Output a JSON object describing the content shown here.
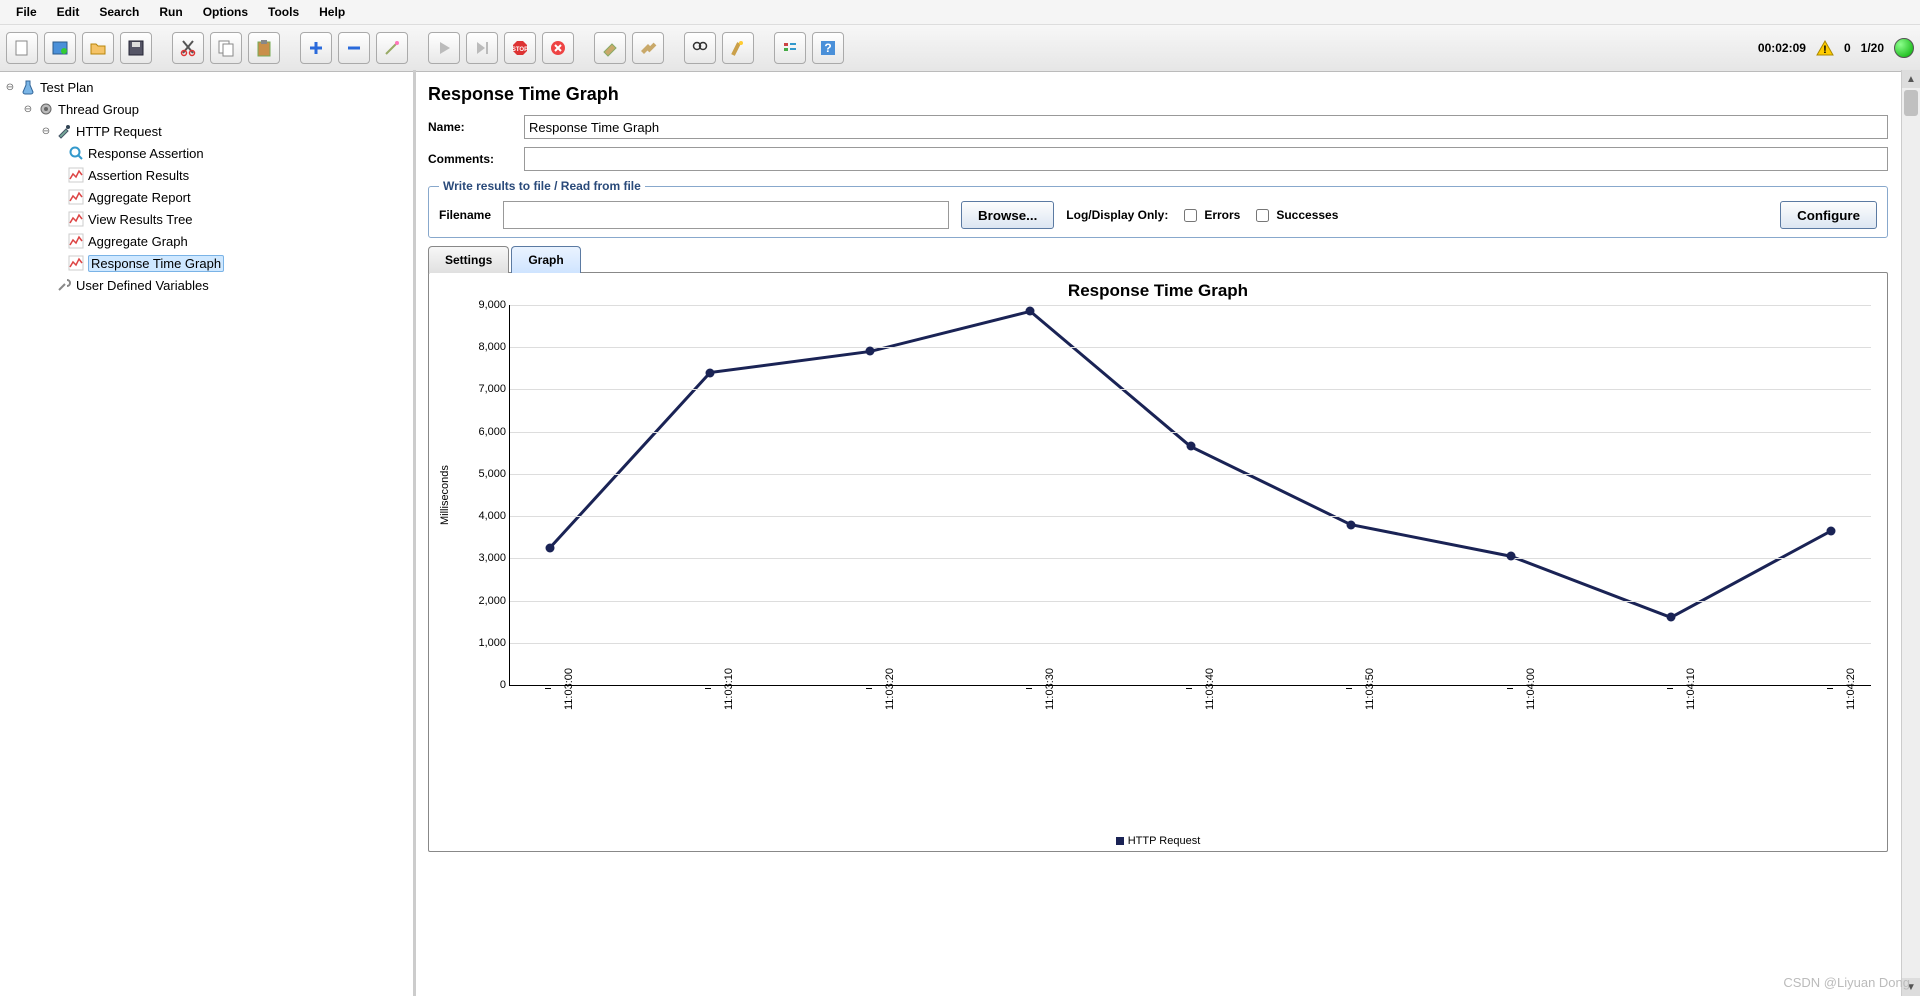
{
  "menu": {
    "file": "File",
    "edit": "Edit",
    "search": "Search",
    "run": "Run",
    "options": "Options",
    "tools": "Tools",
    "help": "Help"
  },
  "toolbar": {
    "icons": [
      "new",
      "templates",
      "open",
      "save",
      "cut",
      "copy",
      "paste",
      "plus",
      "minus",
      "wand",
      "start",
      "start-no-pauses",
      "stop",
      "shutdown",
      "clear",
      "clear-all",
      "find",
      "broom",
      "toggle",
      "help"
    ],
    "timer": "00:02:09",
    "warn_count": "0",
    "thread_status": "1/20"
  },
  "tree": {
    "test_plan": "Test Plan",
    "thread_group": "Thread Group",
    "http_request": "HTTP Request",
    "children": [
      "Response Assertion",
      "Assertion Results",
      "Aggregate Report",
      "View Results Tree",
      "Aggregate Graph",
      "Response Time Graph"
    ],
    "selected_index": 5,
    "user_vars": "User Defined Variables"
  },
  "panel": {
    "heading": "Response Time Graph",
    "name_label": "Name:",
    "name_value": "Response Time Graph",
    "comments_label": "Comments:",
    "comments_value": "",
    "fieldset_legend": "Write results to file / Read from file",
    "filename_label": "Filename",
    "filename_value": "",
    "browse_btn": "Browse...",
    "logdisplay": "Log/Display Only:",
    "errors_chk": "Errors",
    "successes_chk": "Successes",
    "configure_btn": "Configure",
    "tabs": {
      "settings": "Settings",
      "graph": "Graph"
    }
  },
  "chart_data": {
    "type": "line",
    "title": "Response Time Graph",
    "ylabel": "Milliseconds",
    "ylim": [
      0,
      9000
    ],
    "yticks": [
      0,
      1000,
      2000,
      3000,
      4000,
      5000,
      6000,
      7000,
      8000,
      9000
    ],
    "ytick_labels": [
      "0",
      "1,000",
      "2,000",
      "3,000",
      "4,000",
      "5,000",
      "6,000",
      "7,000",
      "8,000",
      "9,000"
    ],
    "categories": [
      "11:03:00",
      "11:03:10",
      "11:03:20",
      "11:03:30",
      "11:03:40",
      "11:03:50",
      "11:04:00",
      "11:04:10",
      "11:04:20"
    ],
    "series": [
      {
        "name": "HTTP Request",
        "values": [
          3250,
          7400,
          7900,
          8850,
          5650,
          3800,
          3050,
          1600,
          3650
        ]
      }
    ]
  },
  "watermark": "CSDN @Liyuan Dong"
}
